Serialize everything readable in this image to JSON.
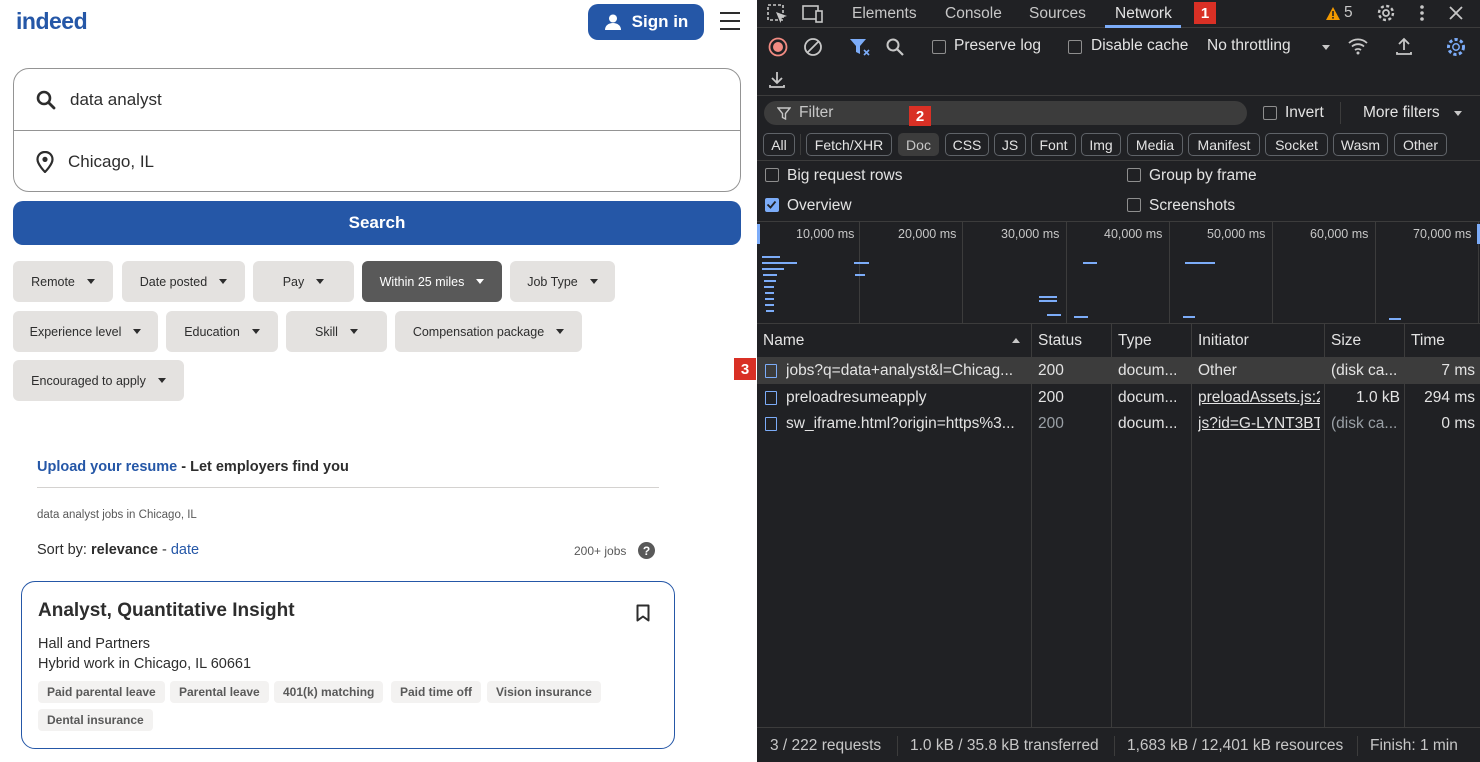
{
  "site": {
    "logo": "indeed",
    "signin_label": "Sign in",
    "search": {
      "what": "data analyst",
      "where": "Chicago, IL",
      "button": "Search"
    },
    "filters": [
      "Remote",
      "Date posted",
      "Pay",
      "Within 25 miles",
      "Job Type",
      "Experience level",
      "Education",
      "Skill",
      "Compensation package",
      "Encouraged to apply"
    ],
    "active_filter": "Within 25 miles",
    "upload_link": "Upload your resume",
    "upload_rest": " - Let employers find you",
    "breadcrumb": "data analyst jobs in Chicago, IL",
    "sort_prefix": "Sort by: ",
    "sort_relevance": "relevance",
    "sort_sep": " - ",
    "sort_date": "date",
    "job_count": "200+ jobs",
    "help": "?",
    "job": {
      "title": "Analyst, Quantitative Insight",
      "company": "Hall and Partners",
      "location": "Hybrid work in Chicago, IL 60661",
      "tags": [
        "Paid parental leave",
        "Parental leave",
        "401(k) matching",
        "Paid time off",
        "Vision insurance",
        "Dental insurance"
      ]
    }
  },
  "devtools": {
    "tabs": [
      "Elements",
      "Console",
      "Sources",
      "Network"
    ],
    "active_tab": "Network",
    "badge1": "1",
    "badge2": "2",
    "badge3": "3",
    "warnings": "5",
    "preserve_log": "Preserve log",
    "disable_cache": "Disable cache",
    "throttling": "No throttling",
    "filter_placeholder": "Filter",
    "invert": "Invert",
    "more_filters": "More filters",
    "types": [
      "All",
      "Fetch/XHR",
      "Doc",
      "CSS",
      "JS",
      "Font",
      "Img",
      "Media",
      "Manifest",
      "Socket",
      "Wasm",
      "Other"
    ],
    "active_type": "Doc",
    "big_rows": "Big request rows",
    "group_by_frame": "Group by frame",
    "overview": "Overview",
    "screenshots": "Screenshots",
    "overview_checked": true,
    "timeline_labels": [
      "10,000 ms",
      "20,000 ms",
      "30,000 ms",
      "40,000 ms",
      "50,000 ms",
      "60,000 ms",
      "70,000 ms"
    ],
    "columns": [
      "Name",
      "Status",
      "Type",
      "Initiator",
      "Size",
      "Time"
    ],
    "rows": [
      {
        "name": "jobs?q=data+analyst&l=Chicag...",
        "status": "200",
        "type": "docum...",
        "initiator": "Other",
        "size": "(disk ca...",
        "time": "7 ms"
      },
      {
        "name": "preloadresumeapply",
        "status": "200",
        "type": "docum...",
        "initiator": "preloadAssets.js:2",
        "size": "1.0 kB",
        "time": "294 ms"
      },
      {
        "name": "sw_iframe.html?origin=https%3...",
        "status": "200",
        "type": "docum...",
        "initiator": "js?id=G-LYNT3BT",
        "size": "(disk ca...",
        "time": "0 ms"
      }
    ],
    "status": {
      "requests": "3 / 222 requests",
      "transferred": "1.0 kB / 35.8 kB transferred",
      "resources": "1,683 kB / 12,401 kB resources",
      "finish": "Finish: 1 min"
    }
  }
}
